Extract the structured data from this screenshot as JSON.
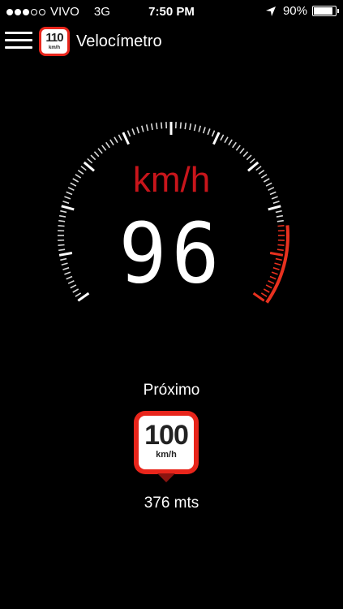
{
  "status_bar": {
    "signal_full": 3,
    "signal_empty": 2,
    "carrier": "VIVO",
    "network": "3G",
    "time": "7:50 PM",
    "battery_text": "90%",
    "battery_level": 0.9
  },
  "nav": {
    "menu_icon": "hamburger-menu-icon",
    "logo_number": "110",
    "logo_unit": "km/h",
    "title": "Velocímetro"
  },
  "gauge": {
    "unit": "km/h",
    "speed": "96",
    "limit_fraction_start": 0.84,
    "colors": {
      "ticks": "#ffffff",
      "over_limit": "#e8311f"
    }
  },
  "next": {
    "label": "Próximo",
    "sign_number": "100",
    "sign_unit": "km/h",
    "distance": "376 mts"
  },
  "colors": {
    "accent": "#e8251b",
    "unit_text": "#c8151b",
    "background": "#000000"
  }
}
